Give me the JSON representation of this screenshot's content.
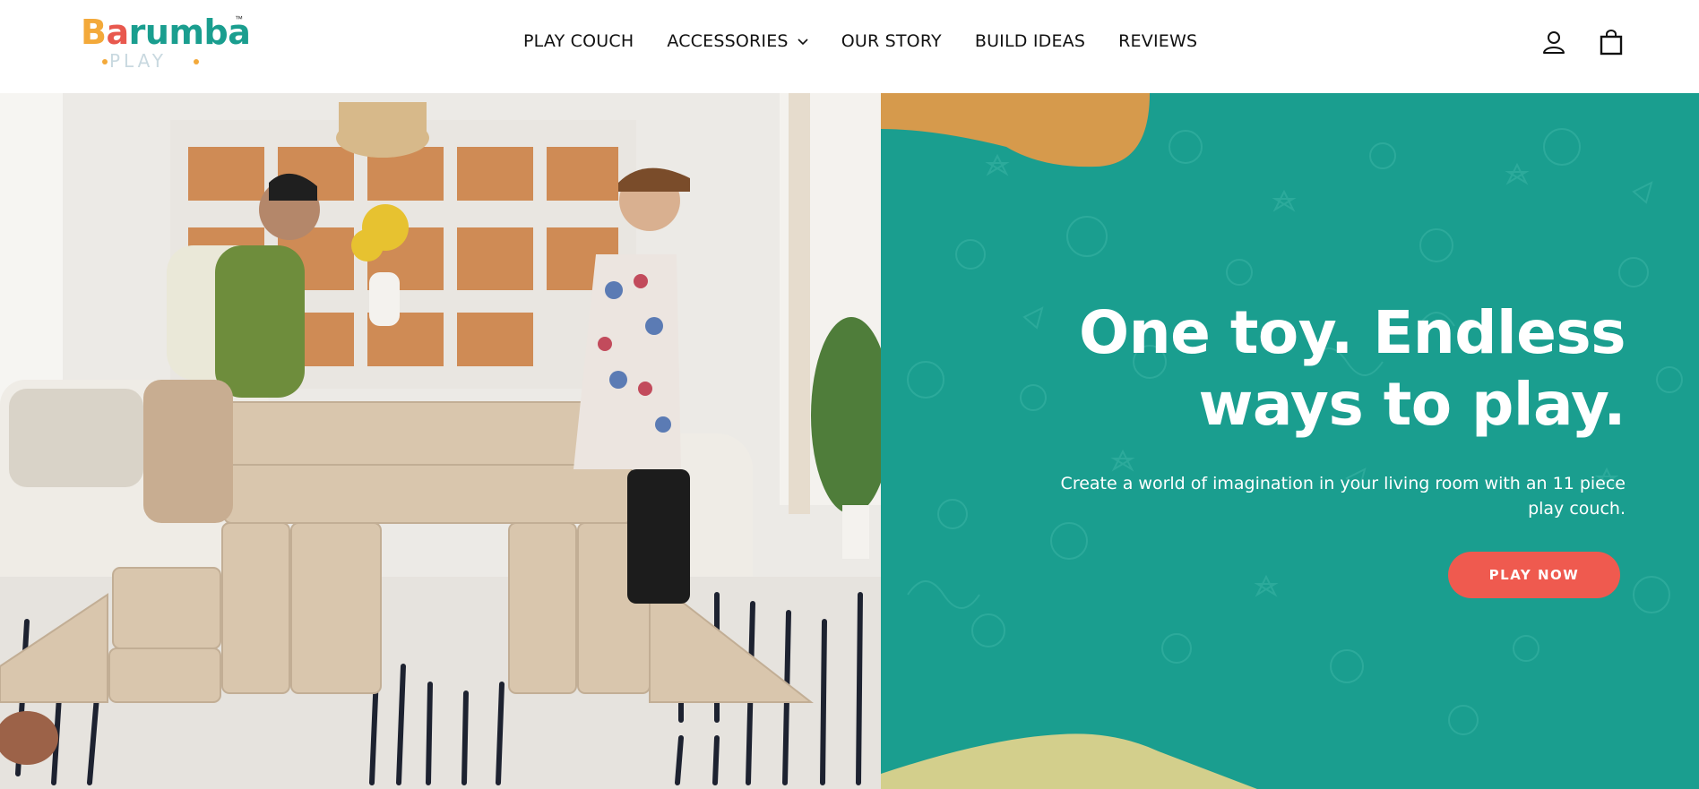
{
  "brand": {
    "name_letters": [
      "B",
      "a",
      "r",
      "u",
      "m",
      "b",
      "a"
    ],
    "name_colors": [
      "#f3a93a",
      "#e8584e",
      "#1a9e8f",
      "#f3a93a",
      "#1a9e8f",
      "#e8584e",
      "#1a9e8f"
    ],
    "tm": "™",
    "sub": "PLAY"
  },
  "nav": {
    "items": [
      {
        "label": "PLAY COUCH"
      },
      {
        "label": "ACCESSORIES"
      },
      {
        "label": "OUR STORY"
      },
      {
        "label": "BUILD IDEAS"
      },
      {
        "label": "REVIEWS"
      }
    ]
  },
  "header_icons": {
    "account": "user-icon",
    "cart": "shopping-bag-icon"
  },
  "hero": {
    "headline_line1": "One toy. Endless",
    "headline_line2": "ways to play.",
    "subtext_line1": "Create a world of imagination in your living room with an 11 piece",
    "subtext_line2": "play couch.",
    "cta_label": "PLAY NOW",
    "image_alt": "Two children playing on a beige modular play couch in a living room"
  },
  "colors": {
    "teal": "#1a9e8f",
    "coral": "#ef5a4f",
    "orange_blob": "#d69a4c",
    "yellow_blob": "#d3cf8c"
  }
}
